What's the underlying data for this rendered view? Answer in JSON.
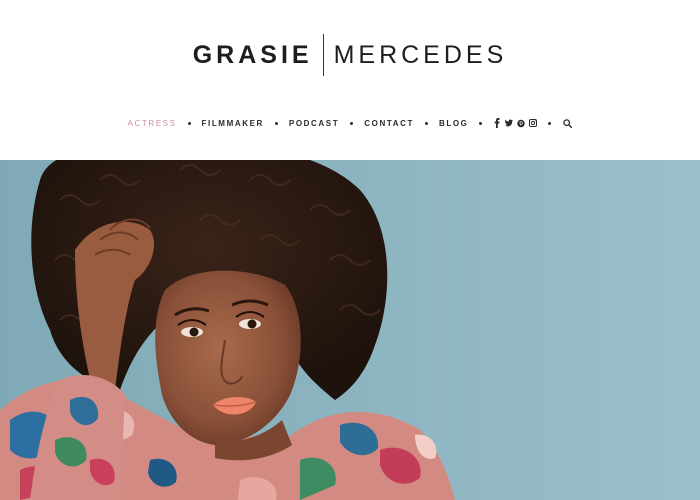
{
  "site": {
    "logo_first": "GRASIE",
    "logo_last": "MERCEDES"
  },
  "nav": {
    "items": [
      {
        "label": "ACTRESS",
        "active": true
      },
      {
        "label": "FILMMAKER",
        "active": false
      },
      {
        "label": "PODCAST",
        "active": false
      },
      {
        "label": "CONTACT",
        "active": false
      },
      {
        "label": "BLOG",
        "active": false
      }
    ],
    "social_icons": [
      "facebook-icon",
      "twitter-icon",
      "pinterest-icon",
      "instagram-icon"
    ],
    "search_icon": "search-icon"
  },
  "colors": {
    "active_nav": "#c9939d",
    "text": "#1d1d1d",
    "hero_background": "#8fb6c2"
  },
  "hero": {
    "image": "portrait-photo"
  }
}
